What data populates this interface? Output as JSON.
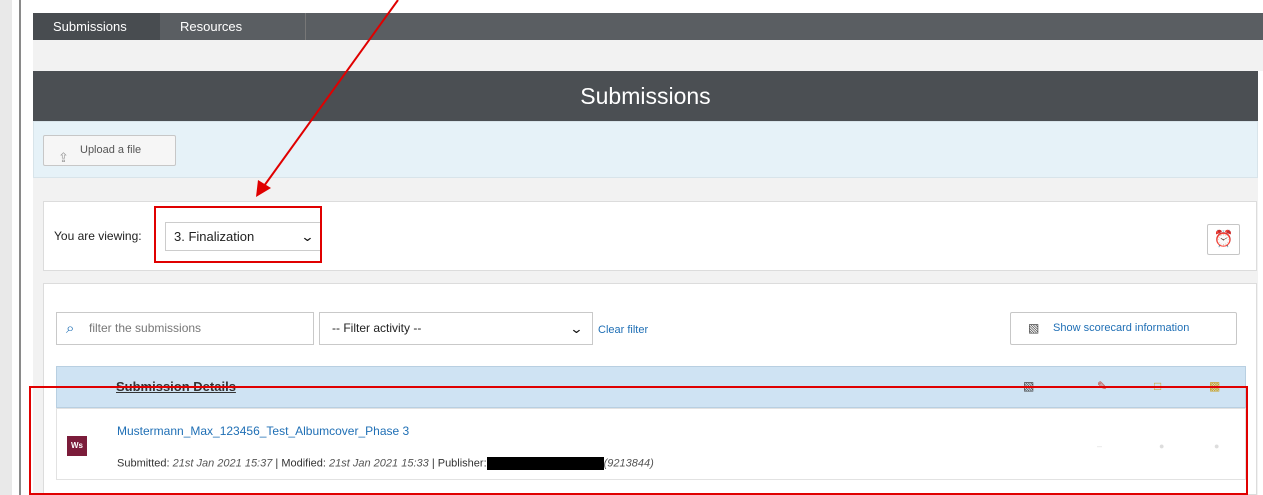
{
  "nav": {
    "tabs": [
      {
        "label": "Submissions"
      },
      {
        "label": "Resources"
      }
    ]
  },
  "header": {
    "title": "Submissions"
  },
  "upload": {
    "label": "Upload a file"
  },
  "viewing": {
    "label": "You are viewing:",
    "selected": "3. Finalization"
  },
  "filter": {
    "search_placeholder": "filter the submissions",
    "activity_selected": "-- Filter activity --",
    "clear_label": "Clear filter",
    "scorecard_label": "Show scorecard information"
  },
  "table": {
    "header": "Submission Details",
    "rows": [
      {
        "badge": "Ws",
        "filename": "Mustermann_Max_123456_Test_Albumcover_Phase 3",
        "submitted_label": "Submitted:",
        "submitted": "21st Jan 2021 15:37",
        "modified_label": "| Modified:",
        "modified": "21st Jan 2021 15:33",
        "publisher_label": "| Publisher:",
        "publisher_suffix": "(9213844)"
      }
    ]
  },
  "colors": {
    "annotation": "#e00000",
    "header": "#4b4f53",
    "link": "#1f6fb5"
  }
}
